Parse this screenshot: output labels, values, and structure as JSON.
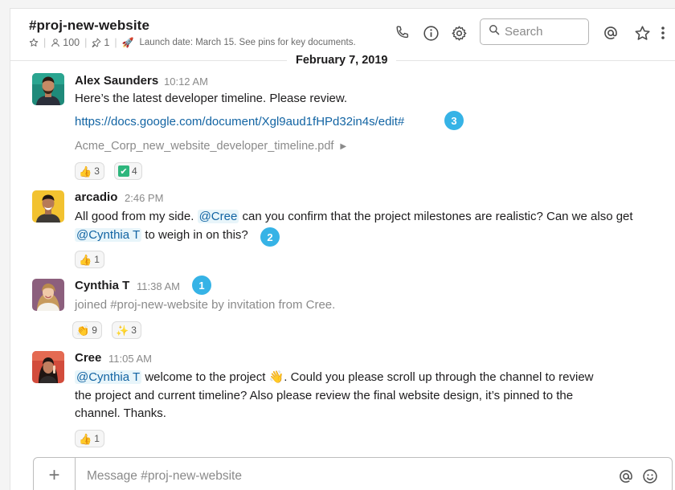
{
  "header": {
    "channel_name": "#proj-new-website",
    "members_count": "100",
    "pins_count": "1",
    "topic": "Launch date: March 15. See pins for key documents.",
    "search_placeholder": "Search"
  },
  "date_divider": "February 7, 2019",
  "messages": [
    {
      "sender": "Alex Saunders",
      "time": "10:12 AM",
      "text": "Here’s the latest developer timeline. Please review.",
      "link": "https://docs.google.com/document/Xgl9aud1fHPd32in4s/edit#",
      "badge": "3",
      "file_name": "Acme_Corp_new_website_developer_timeline.pdf",
      "reactions": [
        {
          "emoji": "👍",
          "count": "3"
        },
        {
          "emoji": "✔",
          "count": "4"
        }
      ]
    },
    {
      "sender": "arcadio",
      "time": "2:46 PM",
      "text_part1": "All good from my side.",
      "mention1": "@Cree",
      "text_part2": "can you confirm that the project milestones are realistic? Can we also get",
      "mention2": "@Cynthia T",
      "text_part3": "to weigh in on this?",
      "badge": "2",
      "reactions": [
        {
          "emoji": "👍",
          "count": "1"
        }
      ]
    },
    {
      "sender": "Cynthia T",
      "time": "11:38 AM",
      "badge": "1",
      "text": "joined #proj-new-website by invitation from Cree.",
      "reactions": [
        {
          "emoji": "👏",
          "count": "9"
        },
        {
          "emoji": "✨",
          "count": "3"
        }
      ]
    },
    {
      "sender": "Cree",
      "time": "11:05 AM",
      "mention": "@Cynthia T",
      "text_part1": "welcome to the project",
      "emoji": "👋",
      "text_part2": ". Could you please scroll up through the channel to review",
      "line2": "the project and current timeline? Also please review the final website design, it’s pinned to the",
      "line3": "channel. Thanks.",
      "reactions": [
        {
          "emoji": "👍",
          "count": "1"
        }
      ]
    }
  ],
  "composer": {
    "placeholder": "Message #proj-new-website"
  },
  "icons": {
    "header": [
      "phone-icon",
      "info-icon",
      "gear-icon",
      "search-icon",
      "at-icon",
      "star-icon",
      "more-vertical-icon"
    ],
    "composer": [
      "plus-icon",
      "at-icon",
      "emoji-icon"
    ]
  },
  "colors": {
    "link": "#1264a3",
    "mention_bg": "#e8f5fa",
    "badge": "#36b3e6",
    "check_green": "#2eb67d"
  }
}
